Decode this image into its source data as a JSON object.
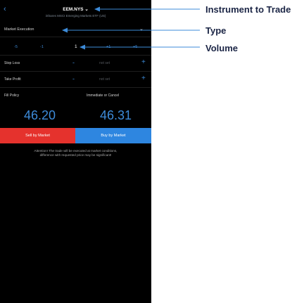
{
  "header": {
    "back_label": "‹",
    "instrument": "EEM.NYS",
    "instrument_chevron": "⌄",
    "description": "iShares MSCI Emerging Markets ETF (US)"
  },
  "order_type": {
    "label": "Market Execution",
    "chevron": "⌄"
  },
  "volume": {
    "dec_large": "-5",
    "dec_small": "-1",
    "value": "1",
    "inc_small": "+1",
    "inc_large": "+5"
  },
  "stop_loss": {
    "label": "Stop Loss",
    "minus": "-",
    "value": "not set",
    "plus": "+"
  },
  "take_profit": {
    "label": "Take Profit",
    "minus": "-",
    "value": "not set",
    "plus": "+"
  },
  "fill_policy": {
    "label": "Fill Policy",
    "value": "Immediate or Cancel"
  },
  "prices": {
    "bid": "46.20",
    "ask": "46.31"
  },
  "buttons": {
    "sell": "Sell by Market",
    "buy": "Buy by Market"
  },
  "note": {
    "line1": "Attention! The trade will be executed at market conditions,",
    "line2": "difference with requested price may be significant!"
  },
  "annotations": {
    "instrument": "Instrument to Trade",
    "type": "Type",
    "volume": "Volume"
  },
  "colors": {
    "sell": "#e5322d",
    "buy": "#2e86e0",
    "price": "#3d8bd9",
    "accent": "#3d8bd9",
    "annotation": "#1b2545"
  }
}
